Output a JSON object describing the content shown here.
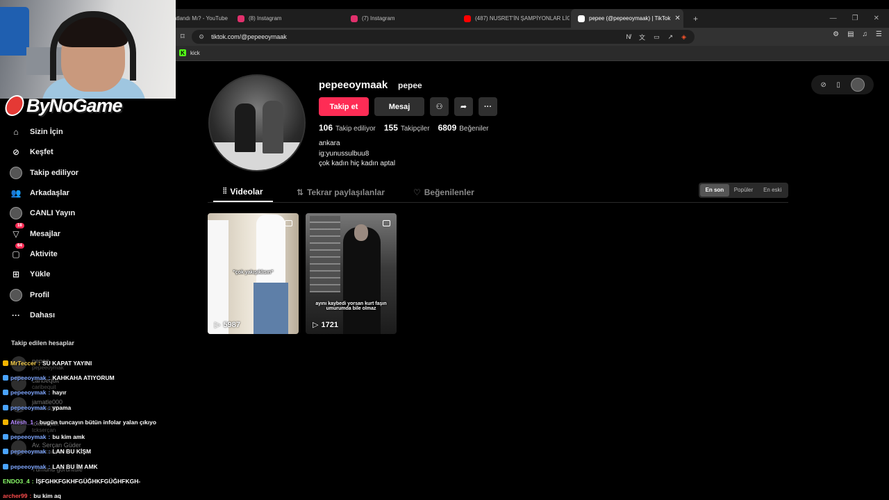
{
  "browser": {
    "tabs": [
      {
        "label": "atlandı Mı? - YouTube",
        "active": false,
        "icon_color": "#ff0000"
      },
      {
        "label": "(8) Instagram",
        "active": false,
        "icon_color": "#e1306c"
      },
      {
        "label": "(7) Instagram",
        "active": false,
        "icon_color": "#e1306c"
      },
      {
        "label": "(487) NUSRET'İN ŞAMPİYONLAR LİGİ",
        "active": false,
        "icon_color": "#ff0000"
      },
      {
        "label": "pepee (@pepeeoymaak) | TikTok",
        "active": true,
        "icon_color": "#ffffff"
      }
    ],
    "url": "tiktok.com/@pepeeoymaak",
    "bookmark": "kick"
  },
  "brand": {
    "name": "ByNoGame"
  },
  "sidebar": {
    "items": [
      {
        "label": "Sizin İçin",
        "icon": "home-icon",
        "badge": ""
      },
      {
        "label": "Keşfet",
        "icon": "compass-icon",
        "badge": ""
      },
      {
        "label": "Takip ediliyor",
        "icon": "following-avatar-icon",
        "badge": ""
      },
      {
        "label": "Arkadaşlar",
        "icon": "friends-icon",
        "badge": ""
      },
      {
        "label": "CANLI Yayın",
        "icon": "live-icon",
        "badge": ""
      },
      {
        "label": "Mesajlar",
        "icon": "messages-icon",
        "badge": "18"
      },
      {
        "label": "Aktivite",
        "icon": "activity-icon",
        "badge": "64"
      },
      {
        "label": "Yükle",
        "icon": "upload-icon",
        "badge": ""
      },
      {
        "label": "Profil",
        "icon": "profile-icon",
        "badge": ""
      },
      {
        "label": "Dahası",
        "icon": "more-icon",
        "badge": ""
      }
    ],
    "following_title": "Takip edilen hesaplar",
    "following": [
      {
        "name": "pepee",
        "user": "pepeeoymak"
      },
      {
        "name": "caribequit",
        "user": "caribequit"
      },
      {
        "name": "jamatle000",
        "user": "jamatle000"
      },
      {
        "name": "tckserçan",
        "user": "tckserçan"
      },
      {
        "name": "Av. Serçan Güder",
        "user": "avsercanguder"
      }
    ],
    "show_all": "Tümünü görüntüle"
  },
  "chat": [
    {
      "user": "MrTeccer",
      "user_color": "#ffd54f",
      "badge_color": "#f4b400",
      "message": "SU KAPAT YAYINI"
    },
    {
      "user": "pepeeoymak",
      "user_color": "#7fa7ff",
      "badge_color": "#4aa3ff",
      "message": "KAHKAHA ATIYORUM"
    },
    {
      "user": "pepeeoymak",
      "user_color": "#7fa7ff",
      "badge_color": "#4aa3ff",
      "message": "hayır"
    },
    {
      "user": "pepeeoymak",
      "user_color": "#7fa7ff",
      "badge_color": "#4aa3ff",
      "message": "ypama"
    },
    {
      "user": "Atesh_1",
      "user_color": "#b388ff",
      "badge_color": "#f4b400",
      "message": "bugün tuncayın bütün infolar yalan çıkıyo"
    },
    {
      "user": "pepeeoymak",
      "user_color": "#7fa7ff",
      "badge_color": "#4aa3ff",
      "message": "bu kim amk"
    },
    {
      "user": "pepeeoymak",
      "user_color": "#7fa7ff",
      "badge_color": "#4aa3ff",
      "message": "LAN BU KİŞM"
    },
    {
      "user": "pepeeoymak",
      "user_color": "#7fa7ff",
      "badge_color": "#4aa3ff",
      "message": "LAN BU İM AMK"
    },
    {
      "user": "ENDO3_4",
      "user_color": "#8dff6b",
      "badge_color": "",
      "message": "İŞFGHKFGKHFGÜĞHKFGÜĞHFKGH-"
    },
    {
      "user": "archer99",
      "user_color": "#ff4d4d",
      "badge_color": "",
      "message": "bu kim aq"
    }
  ],
  "profile": {
    "username": "pepeeoymaak",
    "nickname": "pepee",
    "follow_label": "Takip et",
    "message_label": "Mesaj",
    "stats": {
      "following": "106",
      "following_label": "Takip ediliyor",
      "followers": "155",
      "followers_label": "Takipçiler",
      "likes": "6809",
      "likes_label": "Beğeniler"
    },
    "bio": [
      "ankara",
      "ig:yunussulbuu8",
      "çok kadın hiç kadın aptal"
    ]
  },
  "tabs": [
    {
      "label": "Videolar",
      "active": true
    },
    {
      "label": "Tekrar paylaşılanlar",
      "active": false
    },
    {
      "label": "Beğenilenler",
      "active": false
    }
  ],
  "sort": [
    "En son",
    "Popüler",
    "En eski"
  ],
  "videos": [
    {
      "caption": "\"çok yakışıklısın\"",
      "views": "5987"
    },
    {
      "caption": "ayını kaybedi yorsan kurt faşın umurumda bile olmaz",
      "views": "1721"
    }
  ]
}
